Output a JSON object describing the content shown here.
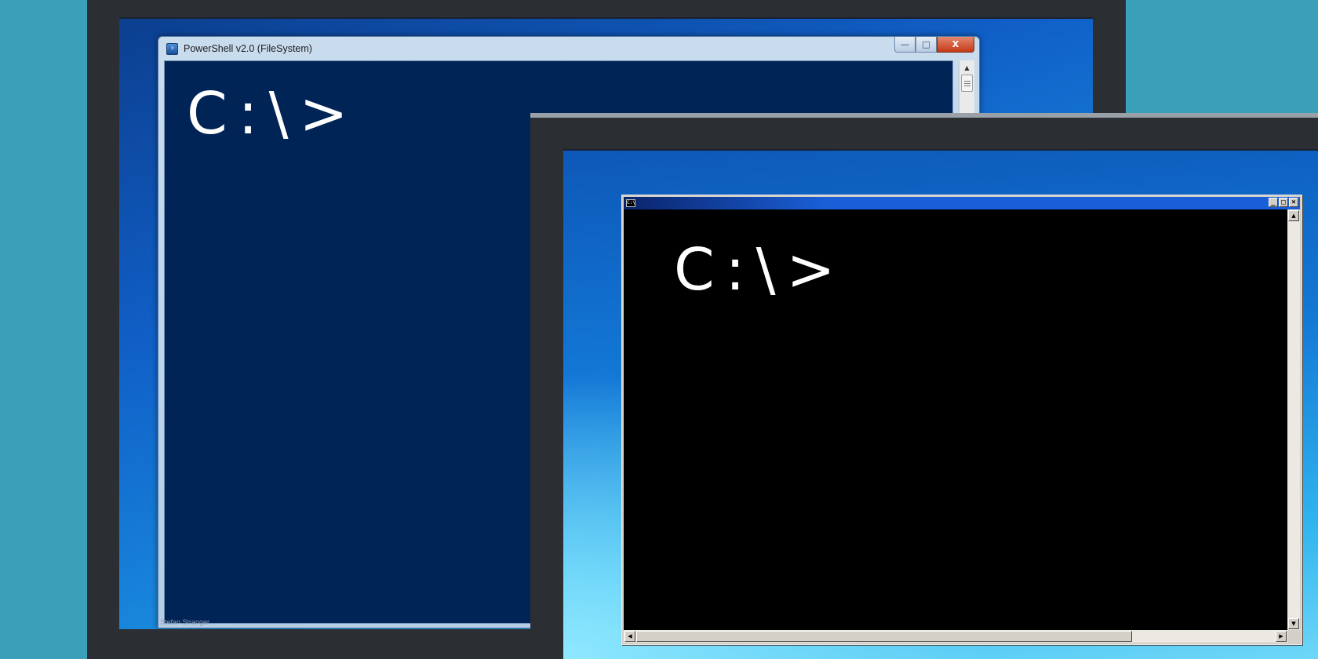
{
  "powershell_window": {
    "title": "PowerShell v2.0 (FileSystem)",
    "prompt": "C:\\>",
    "icon": "powershell-icon",
    "controls": {
      "minimize": "—",
      "maximize": "□",
      "close": "X"
    },
    "scroll_up": "▲",
    "watermark": "Stefan Stranger"
  },
  "cmd_window": {
    "icon_label": "C:\\",
    "prompt": "C:\\>",
    "controls": {
      "minimize": "_",
      "maximize": "□",
      "close": "×"
    },
    "scroll_up": "▲",
    "scroll_down": "▼",
    "scroll_left": "◀",
    "scroll_right": "▶"
  },
  "colors": {
    "powershell_console_bg": "#012456",
    "cmd_console_bg": "#000000",
    "background": "#3a9fb9"
  }
}
